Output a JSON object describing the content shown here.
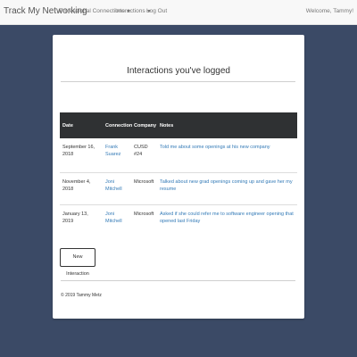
{
  "navbar": {
    "brand": "Track My Networking",
    "items": [
      {
        "label": "Professional Connections",
        "dropdown": true
      },
      {
        "label": "Interactions",
        "dropdown": true
      },
      {
        "label": "Log Out",
        "dropdown": false
      }
    ],
    "welcome": "Welcome, Tammy!"
  },
  "page": {
    "title": "Interactions you've logged"
  },
  "table": {
    "headers": [
      "Date",
      "Connection",
      "Company",
      "Notes"
    ],
    "rows": [
      {
        "date": "September 16, 2018",
        "connection": "Frank Suarez",
        "company": "CUSD #24",
        "notes": "Told me about some openings at his new company"
      },
      {
        "date": "November 4, 2018",
        "connection": "Joni Mitchell",
        "company": "Microsoft",
        "notes": "Talked about new grad openings coming up and gave her my resume"
      },
      {
        "date": "January 13, 2019",
        "connection": "Joni Mitchell",
        "company": "Microsoft",
        "notes": "Asked if she could refer me to software engineer opening that opened last Friday"
      }
    ]
  },
  "actions": {
    "new_interaction_label": "New Interaction"
  },
  "footer": {
    "text": "© 2019 Tammy Metz"
  },
  "colors": {
    "background": "#3b4a66",
    "navbar": "#f8f8f8",
    "table_header": "#2f3133",
    "link": "#337ab7"
  }
}
